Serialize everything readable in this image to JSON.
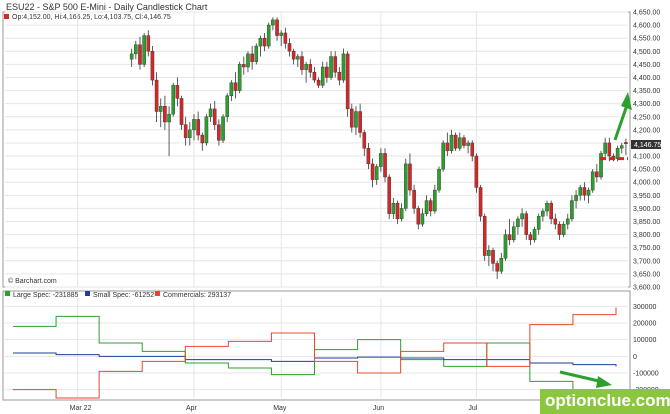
{
  "chart_title": "ESU22 - S&P 500 E-Mini - Daily Candlestick Chart",
  "ohlc_label": "Op:4,152.00, Hi:4,166.25, Lo:4,103.75, Cl:4,146.75",
  "last_price_label": "4,146.75",
  "source_label": "© Barchart.com",
  "watermark": "optionclue.com",
  "colors": {
    "up": "#2ca02c",
    "down": "#d62728",
    "large_spec": "#2ca02c",
    "small_spec": "#1f3f99",
    "commercials": "#e8472f",
    "arrow": "#2ca02c",
    "support_line": "#e0201e"
  },
  "chart_data": [
    {
      "type": "candlestick",
      "title": "ESU22 - S&P 500 E-Mini - Daily Candlestick Chart",
      "ylim": [
        3600,
        4650
      ],
      "y_ticks": [
        "4,650.00",
        "4,600.00",
        "4,550.00",
        "4,500.00",
        "4,450.00",
        "4,400.00",
        "4,350.00",
        "4,300.00",
        "4,250.00",
        "4,200.00",
        "4,150.00",
        "4,100.00",
        "4,050.00",
        "4,000.00",
        "3,950.00",
        "3,900.00",
        "3,850.00",
        "3,800.00",
        "3,750.00",
        "3,700.00",
        "3,650.00",
        "3,600.00"
      ],
      "x_ticks": [
        "Mar 22",
        "Apr",
        "May",
        "Jun",
        "Jul"
      ],
      "x_tick_index": [
        17,
        45,
        66,
        90,
        113
      ],
      "n_bars": 150,
      "grid": true,
      "candles": [
        [
          4470,
          4510,
          4440,
          4490
        ],
        [
          4490,
          4540,
          4470,
          4525
        ],
        [
          4525,
          4555,
          4430,
          4450
        ],
        [
          4450,
          4570,
          4440,
          4560
        ],
        [
          4560,
          4580,
          4480,
          4500
        ],
        [
          4500,
          4520,
          4370,
          4390
        ],
        [
          4390,
          4420,
          4230,
          4270
        ],
        [
          4270,
          4320,
          4210,
          4290
        ],
        [
          4290,
          4330,
          4200,
          4230
        ],
        [
          4230,
          4290,
          4100,
          4260
        ],
        [
          4260,
          4380,
          4250,
          4370
        ],
        [
          4370,
          4400,
          4290,
          4320
        ],
        [
          4320,
          4330,
          4200,
          4220
        ],
        [
          4220,
          4250,
          4140,
          4170
        ],
        [
          4170,
          4230,
          4140,
          4200
        ],
        [
          4200,
          4260,
          4160,
          4240
        ],
        [
          4240,
          4270,
          4160,
          4180
        ],
        [
          4180,
          4190,
          4120,
          4150
        ],
        [
          4150,
          4260,
          4140,
          4250
        ],
        [
          4250,
          4300,
          4230,
          4280
        ],
        [
          4280,
          4310,
          4200,
          4220
        ],
        [
          4220,
          4240,
          4140,
          4160
        ],
        [
          4160,
          4260,
          4150,
          4250
        ],
        [
          4250,
          4340,
          4230,
          4330
        ],
        [
          4330,
          4390,
          4310,
          4380
        ],
        [
          4380,
          4420,
          4320,
          4350
        ],
        [
          4350,
          4460,
          4340,
          4450
        ],
        [
          4450,
          4480,
          4410,
          4440
        ],
        [
          4440,
          4500,
          4420,
          4490
        ],
        [
          4490,
          4520,
          4430,
          4460
        ],
        [
          4460,
          4530,
          4450,
          4520
        ],
        [
          4520,
          4560,
          4480,
          4550
        ],
        [
          4550,
          4570,
          4500,
          4520
        ],
        [
          4520,
          4610,
          4510,
          4600
        ],
        [
          4600,
          4630,
          4580,
          4620
        ],
        [
          4620,
          4630,
          4540,
          4560
        ],
        [
          4560,
          4580,
          4520,
          4570
        ],
        [
          4570,
          4590,
          4510,
          4530
        ],
        [
          4530,
          4550,
          4480,
          4500
        ],
        [
          4500,
          4510,
          4450,
          4470
        ],
        [
          4470,
          4490,
          4440,
          4480
        ],
        [
          4480,
          4500,
          4410,
          4430
        ],
        [
          4430,
          4460,
          4380,
          4450
        ],
        [
          4450,
          4470,
          4400,
          4420
        ],
        [
          4420,
          4440,
          4380,
          4390
        ],
        [
          4390,
          4400,
          4360,
          4370
        ],
        [
          4370,
          4460,
          4360,
          4440
        ],
        [
          4440,
          4460,
          4380,
          4400
        ],
        [
          4400,
          4500,
          4390,
          4480
        ],
        [
          4480,
          4500,
          4400,
          4420
        ],
        [
          4420,
          4440,
          4370,
          4390
        ],
        [
          4390,
          4510,
          4380,
          4490
        ],
        [
          4490,
          4500,
          4250,
          4280
        ],
        [
          4280,
          4300,
          4190,
          4210
        ],
        [
          4210,
          4290,
          4180,
          4270
        ],
        [
          4270,
          4300,
          4170,
          4190
        ],
        [
          4190,
          4200,
          4100,
          4130
        ],
        [
          4130,
          4150,
          4050,
          4070
        ],
        [
          4070,
          4090,
          3980,
          4010
        ],
        [
          4010,
          4070,
          3990,
          4060
        ],
        [
          4060,
          4130,
          4040,
          4110
        ],
        [
          4110,
          4130,
          4000,
          4020
        ],
        [
          4020,
          4030,
          3860,
          3880
        ],
        [
          3880,
          3940,
          3860,
          3920
        ],
        [
          3920,
          3930,
          3840,
          3860
        ],
        [
          3860,
          3920,
          3850,
          3900
        ],
        [
          3900,
          4090,
          3890,
          4070
        ],
        [
          4070,
          4110,
          3950,
          3970
        ],
        [
          3970,
          3990,
          3880,
          3900
        ],
        [
          3900,
          3910,
          3820,
          3840
        ],
        [
          3840,
          3900,
          3830,
          3880
        ],
        [
          3880,
          3950,
          3870,
          3930
        ],
        [
          3930,
          3940,
          3870,
          3890
        ],
        [
          3890,
          3990,
          3880,
          3970
        ],
        [
          3970,
          4060,
          3960,
          4050
        ],
        [
          4050,
          4160,
          4040,
          4150
        ],
        [
          4150,
          4190,
          4100,
          4120
        ],
        [
          4120,
          4200,
          4110,
          4180
        ],
        [
          4180,
          4190,
          4120,
          4130
        ],
        [
          4130,
          4190,
          4120,
          4170
        ],
        [
          4170,
          4180,
          4130,
          4140
        ],
        [
          4140,
          4160,
          4110,
          4150
        ],
        [
          4150,
          4160,
          4080,
          4100
        ],
        [
          4100,
          4110,
          3960,
          3980
        ],
        [
          3980,
          3990,
          3850,
          3870
        ],
        [
          3870,
          3880,
          3700,
          3720
        ],
        [
          3720,
          3760,
          3680,
          3740
        ],
        [
          3740,
          3750,
          3660,
          3690
        ],
        [
          3690,
          3700,
          3630,
          3660
        ],
        [
          3660,
          3730,
          3650,
          3710
        ],
        [
          3710,
          3820,
          3700,
          3800
        ],
        [
          3800,
          3860,
          3760,
          3780
        ],
        [
          3780,
          3850,
          3770,
          3830
        ],
        [
          3830,
          3870,
          3800,
          3860
        ],
        [
          3860,
          3900,
          3830,
          3880
        ],
        [
          3880,
          3890,
          3780,
          3800
        ],
        [
          3800,
          3810,
          3760,
          3780
        ],
        [
          3780,
          3830,
          3770,
          3820
        ],
        [
          3820,
          3880,
          3800,
          3870
        ],
        [
          3870,
          3900,
          3850,
          3890
        ],
        [
          3890,
          3930,
          3870,
          3920
        ],
        [
          3920,
          3930,
          3840,
          3860
        ],
        [
          3860,
          3880,
          3820,
          3840
        ],
        [
          3840,
          3850,
          3780,
          3800
        ],
        [
          3800,
          3850,
          3790,
          3840
        ],
        [
          3840,
          3880,
          3820,
          3860
        ],
        [
          3860,
          3950,
          3850,
          3930
        ],
        [
          3930,
          3970,
          3900,
          3950
        ],
        [
          3950,
          3990,
          3930,
          3980
        ],
        [
          3980,
          4000,
          3930,
          3950
        ],
        [
          3950,
          3980,
          3920,
          3970
        ],
        [
          3970,
          4050,
          3960,
          4040
        ],
        [
          4040,
          4070,
          4000,
          4020
        ],
        [
          4020,
          4120,
          4010,
          4110
        ],
        [
          4110,
          4170,
          4090,
          4150
        ],
        [
          4150,
          4170,
          4080,
          4100
        ],
        [
          4100,
          4110,
          4080,
          4090
        ],
        [
          4090,
          4140,
          4080,
          4130
        ],
        [
          4130,
          4150,
          4110,
          4140
        ],
        [
          4152,
          4166.25,
          4103.75,
          4146.75
        ]
      ],
      "price_line": 4146.75,
      "support_level": 4090,
      "annotations": [
        "green arrow pointing up",
        "red dashed support line"
      ]
    },
    {
      "type": "line",
      "series": [
        {
          "name": "Large Spec",
          "legend": "Large Spec: -231885",
          "values": [
            180000,
            240000,
            80000,
            30000,
            -40000,
            -70000,
            -110000,
            40000,
            100000,
            -20000,
            -60000,
            80000,
            -150000,
            -200000,
            -231885
          ]
        },
        {
          "name": "Small Spec",
          "legend": "Small Spec: -61252",
          "values": [
            20000,
            10000,
            0,
            0,
            -20000,
            -20000,
            -30000,
            -10000,
            -5000,
            -10000,
            -20000,
            -20000,
            -40000,
            -50000,
            -61252
          ]
        },
        {
          "name": "Commercials",
          "legend": "Commercials: 293137",
          "values": [
            -200000,
            -250000,
            -90000,
            -30000,
            60000,
            90000,
            140000,
            -30000,
            -100000,
            30000,
            80000,
            -60000,
            190000,
            250000,
            293137
          ]
        }
      ],
      "ylim": [
        -250000,
        350000
      ],
      "y_ticks": [
        "300000",
        "200000",
        "100000",
        "0",
        "-100000",
        "-200000"
      ],
      "x_ticks": [
        "Mar 22",
        "Apr",
        "May",
        "Jun",
        "Jul"
      ],
      "x_tick_index": [
        3,
        6,
        8,
        11,
        14
      ]
    }
  ]
}
